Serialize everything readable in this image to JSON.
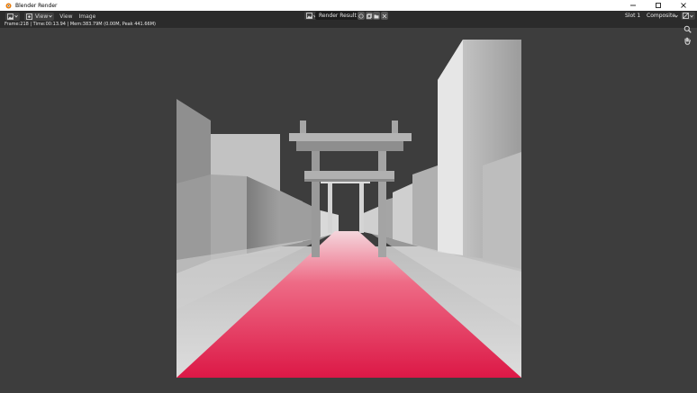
{
  "window": {
    "title": "Blender Render",
    "controls": [
      "minimize",
      "maximize",
      "close"
    ]
  },
  "toolbar": {
    "view_label": "View",
    "view_menu": "View",
    "image_menu": "Image",
    "image_name": "Render Result",
    "slot": "Slot 1",
    "layer": "Composite"
  },
  "status": {
    "text": "Frame:218 | Time:00:13.94 | Mem:383.79M (0.00M, Peak 441.66M)"
  },
  "render": {
    "description_colors": {
      "sky": "#3d3d3d",
      "carpet": "#e0204a",
      "buildings": "#bdbdbd"
    }
  },
  "icons": {
    "app": "blender-icon",
    "editor_type": "image-editor-icon",
    "zoom": "zoom-icon",
    "pan": "hand-icon"
  }
}
